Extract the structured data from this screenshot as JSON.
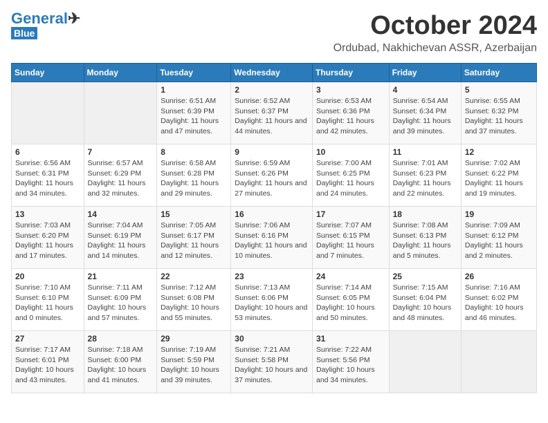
{
  "header": {
    "logo_general": "General",
    "logo_blue": "Blue",
    "title": "October 2024",
    "subtitle": "Ordubad, Nakhichevan ASSR, Azerbaijan"
  },
  "days_of_week": [
    "Sunday",
    "Monday",
    "Tuesday",
    "Wednesday",
    "Thursday",
    "Friday",
    "Saturday"
  ],
  "weeks": [
    [
      {
        "day": "",
        "info": ""
      },
      {
        "day": "",
        "info": ""
      },
      {
        "day": "1",
        "info": "Sunrise: 6:51 AM\nSunset: 6:39 PM\nDaylight: 11 hours and 47 minutes."
      },
      {
        "day": "2",
        "info": "Sunrise: 6:52 AM\nSunset: 6:37 PM\nDaylight: 11 hours and 44 minutes."
      },
      {
        "day": "3",
        "info": "Sunrise: 6:53 AM\nSunset: 6:36 PM\nDaylight: 11 hours and 42 minutes."
      },
      {
        "day": "4",
        "info": "Sunrise: 6:54 AM\nSunset: 6:34 PM\nDaylight: 11 hours and 39 minutes."
      },
      {
        "day": "5",
        "info": "Sunrise: 6:55 AM\nSunset: 6:32 PM\nDaylight: 11 hours and 37 minutes."
      }
    ],
    [
      {
        "day": "6",
        "info": "Sunrise: 6:56 AM\nSunset: 6:31 PM\nDaylight: 11 hours and 34 minutes."
      },
      {
        "day": "7",
        "info": "Sunrise: 6:57 AM\nSunset: 6:29 PM\nDaylight: 11 hours and 32 minutes."
      },
      {
        "day": "8",
        "info": "Sunrise: 6:58 AM\nSunset: 6:28 PM\nDaylight: 11 hours and 29 minutes."
      },
      {
        "day": "9",
        "info": "Sunrise: 6:59 AM\nSunset: 6:26 PM\nDaylight: 11 hours and 27 minutes."
      },
      {
        "day": "10",
        "info": "Sunrise: 7:00 AM\nSunset: 6:25 PM\nDaylight: 11 hours and 24 minutes."
      },
      {
        "day": "11",
        "info": "Sunrise: 7:01 AM\nSunset: 6:23 PM\nDaylight: 11 hours and 22 minutes."
      },
      {
        "day": "12",
        "info": "Sunrise: 7:02 AM\nSunset: 6:22 PM\nDaylight: 11 hours and 19 minutes."
      }
    ],
    [
      {
        "day": "13",
        "info": "Sunrise: 7:03 AM\nSunset: 6:20 PM\nDaylight: 11 hours and 17 minutes."
      },
      {
        "day": "14",
        "info": "Sunrise: 7:04 AM\nSunset: 6:19 PM\nDaylight: 11 hours and 14 minutes."
      },
      {
        "day": "15",
        "info": "Sunrise: 7:05 AM\nSunset: 6:17 PM\nDaylight: 11 hours and 12 minutes."
      },
      {
        "day": "16",
        "info": "Sunrise: 7:06 AM\nSunset: 6:16 PM\nDaylight: 11 hours and 10 minutes."
      },
      {
        "day": "17",
        "info": "Sunrise: 7:07 AM\nSunset: 6:15 PM\nDaylight: 11 hours and 7 minutes."
      },
      {
        "day": "18",
        "info": "Sunrise: 7:08 AM\nSunset: 6:13 PM\nDaylight: 11 hours and 5 minutes."
      },
      {
        "day": "19",
        "info": "Sunrise: 7:09 AM\nSunset: 6:12 PM\nDaylight: 11 hours and 2 minutes."
      }
    ],
    [
      {
        "day": "20",
        "info": "Sunrise: 7:10 AM\nSunset: 6:10 PM\nDaylight: 11 hours and 0 minutes."
      },
      {
        "day": "21",
        "info": "Sunrise: 7:11 AM\nSunset: 6:09 PM\nDaylight: 10 hours and 57 minutes."
      },
      {
        "day": "22",
        "info": "Sunrise: 7:12 AM\nSunset: 6:08 PM\nDaylight: 10 hours and 55 minutes."
      },
      {
        "day": "23",
        "info": "Sunrise: 7:13 AM\nSunset: 6:06 PM\nDaylight: 10 hours and 53 minutes."
      },
      {
        "day": "24",
        "info": "Sunrise: 7:14 AM\nSunset: 6:05 PM\nDaylight: 10 hours and 50 minutes."
      },
      {
        "day": "25",
        "info": "Sunrise: 7:15 AM\nSunset: 6:04 PM\nDaylight: 10 hours and 48 minutes."
      },
      {
        "day": "26",
        "info": "Sunrise: 7:16 AM\nSunset: 6:02 PM\nDaylight: 10 hours and 46 minutes."
      }
    ],
    [
      {
        "day": "27",
        "info": "Sunrise: 7:17 AM\nSunset: 6:01 PM\nDaylight: 10 hours and 43 minutes."
      },
      {
        "day": "28",
        "info": "Sunrise: 7:18 AM\nSunset: 6:00 PM\nDaylight: 10 hours and 41 minutes."
      },
      {
        "day": "29",
        "info": "Sunrise: 7:19 AM\nSunset: 5:59 PM\nDaylight: 10 hours and 39 minutes."
      },
      {
        "day": "30",
        "info": "Sunrise: 7:21 AM\nSunset: 5:58 PM\nDaylight: 10 hours and 37 minutes."
      },
      {
        "day": "31",
        "info": "Sunrise: 7:22 AM\nSunset: 5:56 PM\nDaylight: 10 hours and 34 minutes."
      },
      {
        "day": "",
        "info": ""
      },
      {
        "day": "",
        "info": ""
      }
    ]
  ]
}
